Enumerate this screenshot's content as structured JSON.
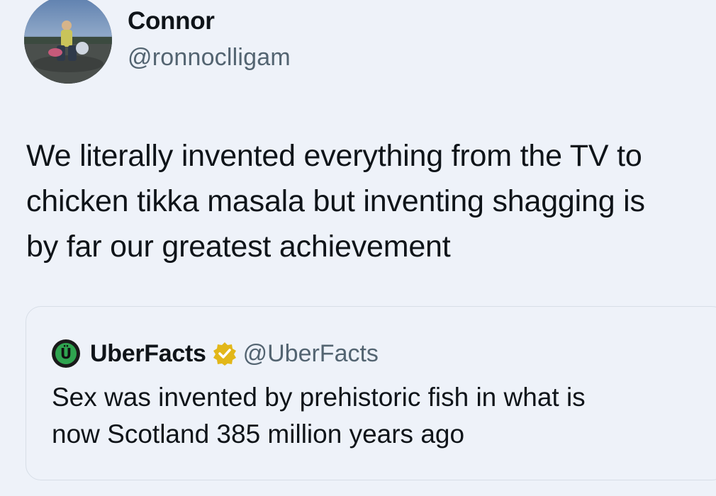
{
  "tweet": {
    "author": {
      "name": "Connor",
      "handle": "@ronnoclligam"
    },
    "text_lines": [
      "We literally invented everything from the TV to",
      "chicken tikka masala but inventing shagging is",
      "by far our greatest achievement"
    ]
  },
  "quoted_tweet": {
    "author": {
      "name": "UberFacts",
      "handle": "@UberFacts",
      "verified": true,
      "avatar_letter": "Ü"
    },
    "text_lines": [
      "Sex was invented by prehistoric fish in what is",
      "now Scotland 385 million years ago"
    ]
  },
  "colors": {
    "background": "#eef2f9",
    "text": "#0f1419",
    "secondary_text": "#536471",
    "verified_badge": "#e2b719",
    "uberfacts_avatar_ring": "#2fa44f"
  }
}
